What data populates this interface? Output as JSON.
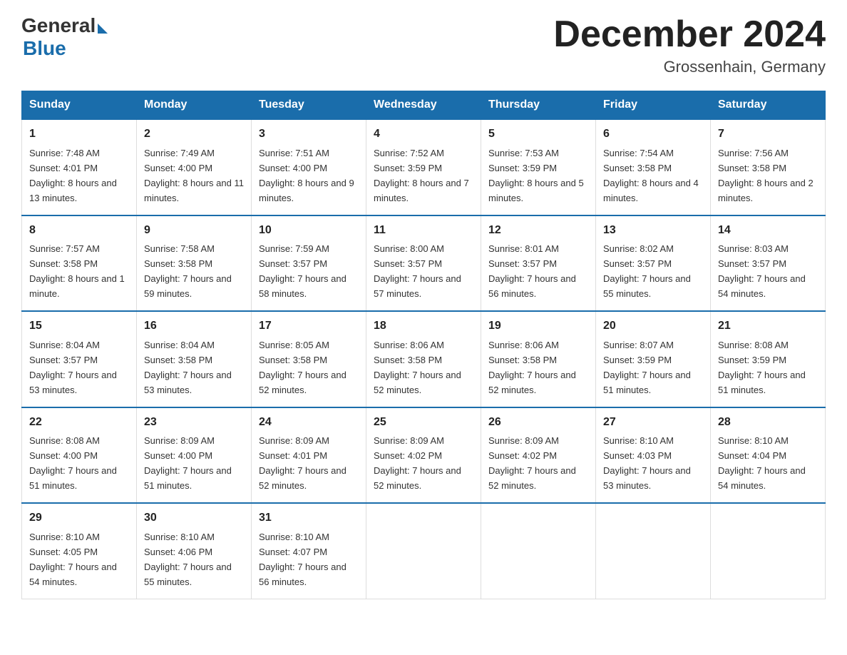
{
  "logo": {
    "general": "General",
    "blue": "Blue"
  },
  "title": "December 2024",
  "location": "Grossenhain, Germany",
  "days_header": [
    "Sunday",
    "Monday",
    "Tuesday",
    "Wednesday",
    "Thursday",
    "Friday",
    "Saturday"
  ],
  "weeks": [
    [
      {
        "num": "1",
        "sunrise": "7:48 AM",
        "sunset": "4:01 PM",
        "daylight": "8 hours and 13 minutes."
      },
      {
        "num": "2",
        "sunrise": "7:49 AM",
        "sunset": "4:00 PM",
        "daylight": "8 hours and 11 minutes."
      },
      {
        "num": "3",
        "sunrise": "7:51 AM",
        "sunset": "4:00 PM",
        "daylight": "8 hours and 9 minutes."
      },
      {
        "num": "4",
        "sunrise": "7:52 AM",
        "sunset": "3:59 PM",
        "daylight": "8 hours and 7 minutes."
      },
      {
        "num": "5",
        "sunrise": "7:53 AM",
        "sunset": "3:59 PM",
        "daylight": "8 hours and 5 minutes."
      },
      {
        "num": "6",
        "sunrise": "7:54 AM",
        "sunset": "3:58 PM",
        "daylight": "8 hours and 4 minutes."
      },
      {
        "num": "7",
        "sunrise": "7:56 AM",
        "sunset": "3:58 PM",
        "daylight": "8 hours and 2 minutes."
      }
    ],
    [
      {
        "num": "8",
        "sunrise": "7:57 AM",
        "sunset": "3:58 PM",
        "daylight": "8 hours and 1 minute."
      },
      {
        "num": "9",
        "sunrise": "7:58 AM",
        "sunset": "3:58 PM",
        "daylight": "7 hours and 59 minutes."
      },
      {
        "num": "10",
        "sunrise": "7:59 AM",
        "sunset": "3:57 PM",
        "daylight": "7 hours and 58 minutes."
      },
      {
        "num": "11",
        "sunrise": "8:00 AM",
        "sunset": "3:57 PM",
        "daylight": "7 hours and 57 minutes."
      },
      {
        "num": "12",
        "sunrise": "8:01 AM",
        "sunset": "3:57 PM",
        "daylight": "7 hours and 56 minutes."
      },
      {
        "num": "13",
        "sunrise": "8:02 AM",
        "sunset": "3:57 PM",
        "daylight": "7 hours and 55 minutes."
      },
      {
        "num": "14",
        "sunrise": "8:03 AM",
        "sunset": "3:57 PM",
        "daylight": "7 hours and 54 minutes."
      }
    ],
    [
      {
        "num": "15",
        "sunrise": "8:04 AM",
        "sunset": "3:57 PM",
        "daylight": "7 hours and 53 minutes."
      },
      {
        "num": "16",
        "sunrise": "8:04 AM",
        "sunset": "3:58 PM",
        "daylight": "7 hours and 53 minutes."
      },
      {
        "num": "17",
        "sunrise": "8:05 AM",
        "sunset": "3:58 PM",
        "daylight": "7 hours and 52 minutes."
      },
      {
        "num": "18",
        "sunrise": "8:06 AM",
        "sunset": "3:58 PM",
        "daylight": "7 hours and 52 minutes."
      },
      {
        "num": "19",
        "sunrise": "8:06 AM",
        "sunset": "3:58 PM",
        "daylight": "7 hours and 52 minutes."
      },
      {
        "num": "20",
        "sunrise": "8:07 AM",
        "sunset": "3:59 PM",
        "daylight": "7 hours and 51 minutes."
      },
      {
        "num": "21",
        "sunrise": "8:08 AM",
        "sunset": "3:59 PM",
        "daylight": "7 hours and 51 minutes."
      }
    ],
    [
      {
        "num": "22",
        "sunrise": "8:08 AM",
        "sunset": "4:00 PM",
        "daylight": "7 hours and 51 minutes."
      },
      {
        "num": "23",
        "sunrise": "8:09 AM",
        "sunset": "4:00 PM",
        "daylight": "7 hours and 51 minutes."
      },
      {
        "num": "24",
        "sunrise": "8:09 AM",
        "sunset": "4:01 PM",
        "daylight": "7 hours and 52 minutes."
      },
      {
        "num": "25",
        "sunrise": "8:09 AM",
        "sunset": "4:02 PM",
        "daylight": "7 hours and 52 minutes."
      },
      {
        "num": "26",
        "sunrise": "8:09 AM",
        "sunset": "4:02 PM",
        "daylight": "7 hours and 52 minutes."
      },
      {
        "num": "27",
        "sunrise": "8:10 AM",
        "sunset": "4:03 PM",
        "daylight": "7 hours and 53 minutes."
      },
      {
        "num": "28",
        "sunrise": "8:10 AM",
        "sunset": "4:04 PM",
        "daylight": "7 hours and 54 minutes."
      }
    ],
    [
      {
        "num": "29",
        "sunrise": "8:10 AM",
        "sunset": "4:05 PM",
        "daylight": "7 hours and 54 minutes."
      },
      {
        "num": "30",
        "sunrise": "8:10 AM",
        "sunset": "4:06 PM",
        "daylight": "7 hours and 55 minutes."
      },
      {
        "num": "31",
        "sunrise": "8:10 AM",
        "sunset": "4:07 PM",
        "daylight": "7 hours and 56 minutes."
      },
      null,
      null,
      null,
      null
    ]
  ]
}
